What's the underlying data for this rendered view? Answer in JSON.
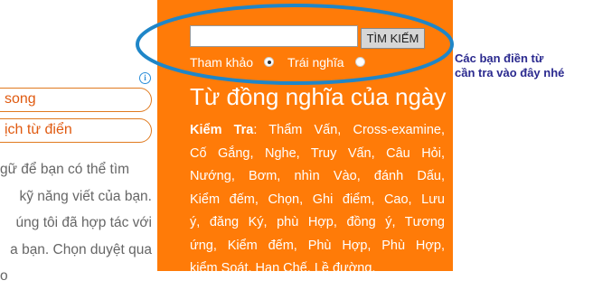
{
  "left": {
    "pill1": "song",
    "pill2": "ịch từ điển",
    "para_lines": [
      "gữ để bạn có thể tìm",
      "kỹ năng viết của bạn.",
      "úng tôi đã hợp tác với",
      "a bạn. Chọn duyệt qua",
      "o"
    ]
  },
  "search": {
    "input_value": "",
    "button_label": "TÌM KIẾM",
    "option1": "Tham khảo",
    "option2": "Trái nghĩa"
  },
  "day": {
    "title": "Từ đồng nghĩa của ngày",
    "keyword": "Kiểm Tra",
    "line1": ": Thẩm Vấn, Cross-examine,",
    "lines": [
      "Cố Gắng, Nghe, Truy Vấn, Câu Hỏi,",
      "Nướng, Bơm, nhìn Vào, đánh Dấu,",
      "Kiểm đếm, Chọn, Ghi điểm, Cao, Lưu",
      "ý, đăng Ký, phù Hợp, đồng ý, Tương",
      "ứng, Kiểm đếm, Phù Hợp, Phù Hợp,",
      "kiểm Soát, Hạn Chế, Lề đường,"
    ]
  },
  "annotation": {
    "line1": "Các bạn điền từ",
    "line2": "cần tra vào đây nhé"
  },
  "colors": {
    "panel": "#ff7b08",
    "ellipse": "#1f86c8",
    "note": "#2b2a8f"
  }
}
